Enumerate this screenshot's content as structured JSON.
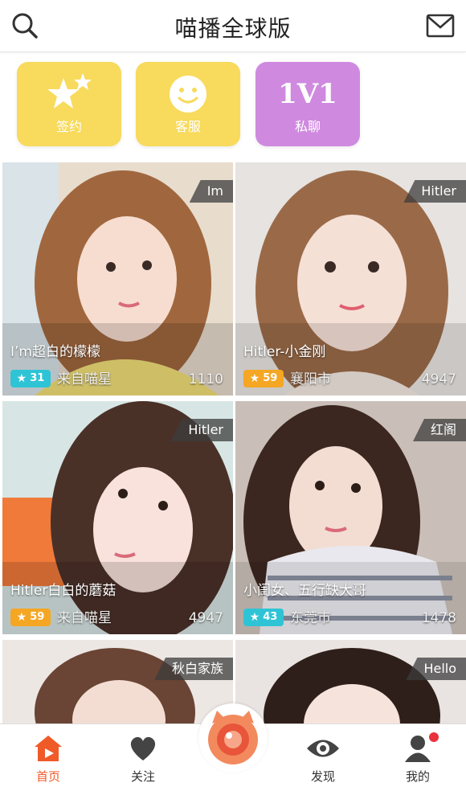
{
  "header": {
    "title": "喵播全球版",
    "search_icon": "search-icon",
    "mail_icon": "mail-icon"
  },
  "quick_actions": [
    {
      "label": "签约",
      "icon": "stars-icon",
      "color": "#f8da5c"
    },
    {
      "label": "客服",
      "icon": "smiley-icon",
      "color": "#f8da5c"
    },
    {
      "label": "私聊",
      "icon_text": "1V1",
      "color": "#cf8ae0"
    }
  ],
  "cards": [
    {
      "tag": "Im",
      "name": "I’m超白的檬檬",
      "level": "31",
      "level_color": "#2ec4d6",
      "location": "来自喵星",
      "count": "1110"
    },
    {
      "tag": "Hitler",
      "name": "Hitler-小金刚",
      "level": "59",
      "level_color": "#f5a623",
      "location": "襄阳市",
      "count": "4947"
    },
    {
      "tag": "Hitler",
      "name": "Hitler白白的蘑菇",
      "level": "59",
      "level_color": "#f5a623",
      "location": "来自喵星",
      "count": "4947"
    },
    {
      "tag": "红阁",
      "name": "小闺女、五行缺大哥",
      "level": "43",
      "level_color": "#2ec4d6",
      "location": "东莞市",
      "count": "1478"
    },
    {
      "tag": "秋白家族",
      "name": "",
      "level": "",
      "location": "",
      "count": ""
    },
    {
      "tag": "Hello",
      "name": "",
      "level": "",
      "location": "",
      "count": ""
    }
  ],
  "tabbar": {
    "home": "首页",
    "follow": "关注",
    "discover": "发现",
    "mine": "我的",
    "accent": "#f05a28"
  }
}
